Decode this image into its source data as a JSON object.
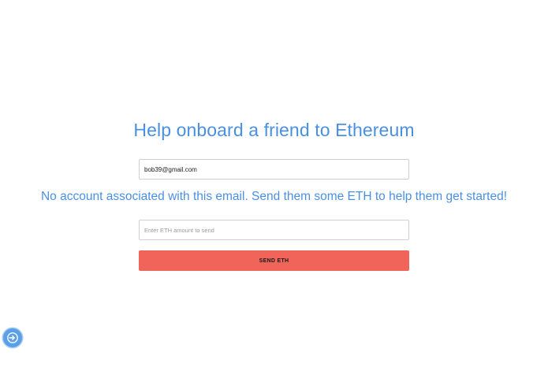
{
  "title": "Help onboard a friend to Ethereum",
  "email_field": {
    "value": "bob39@gmail.com",
    "placeholder": ""
  },
  "message": "No account associated with this email. Send them some ETH to help them get started!",
  "amount_field": {
    "value": "",
    "placeholder": "Enter ETH amount to send"
  },
  "send_button": {
    "label": "SEND ETH"
  },
  "floating_button": {
    "icon": "login-arrow-icon"
  },
  "colors": {
    "accent": "#4a90e2",
    "button": "#f0645a",
    "fab": "#5b9fe8"
  }
}
